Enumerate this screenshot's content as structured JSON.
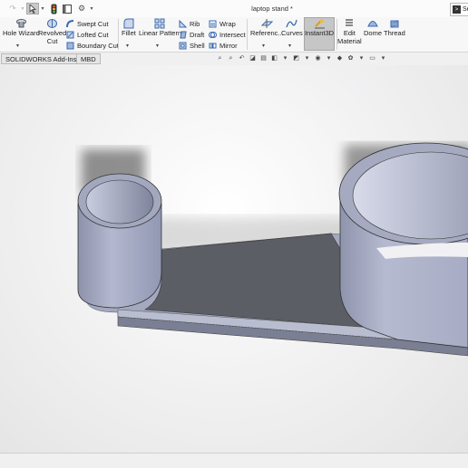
{
  "window": {
    "title": "laptop stand *",
    "search_text": "Se"
  },
  "quick_access": {
    "redo_icon": "redo-arrow",
    "select_icon": "cursor-arrow",
    "rebuild_icon": "traffic-light",
    "options_icon": "sheet-panel",
    "grid_icon": "gear"
  },
  "ribbon": {
    "hole_wizard": "Hole Wizard",
    "revolved_cut_line1": "Revolved",
    "revolved_cut_line2": "Cut",
    "swept_cut": "Swept Cut",
    "lofted_cut": "Lofted Cut",
    "boundary_cut": "Boundary Cut",
    "fillet": "Fillet",
    "linear_pattern": "Linear Pattern",
    "rib": "Rib",
    "draft": "Draft",
    "shell": "Shell",
    "wrap": "Wrap",
    "intersect": "Intersect",
    "mirror": "Mirror",
    "reference": "Referenc...",
    "curves": "Curves",
    "instant3d": "Instant3D",
    "edit_material_line1": "Edit",
    "edit_material_line2": "Material",
    "dome": "Dome",
    "thread": "Thread"
  },
  "tabs": [
    {
      "label": "SOLIDWORKS Add-Ins"
    },
    {
      "label": "MBD"
    }
  ],
  "colors": {
    "accent_blue": "#3a7bd5",
    "model_face": "#a7acc4",
    "model_dark": "#5c5e66",
    "instant3d_active": "#c6c6c6"
  }
}
